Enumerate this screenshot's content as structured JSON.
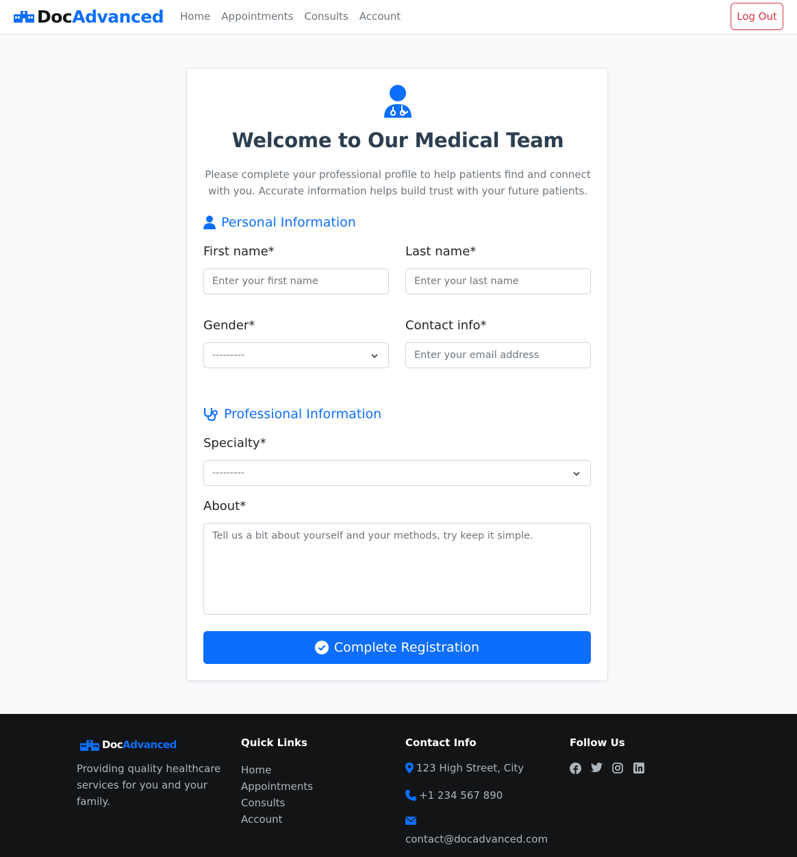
{
  "brand": {
    "part1": "Doc",
    "part2": "Advanced"
  },
  "nav": {
    "links": [
      "Home",
      "Appointments",
      "Consults",
      "Account"
    ],
    "logout_label": "Log Out"
  },
  "card": {
    "title": "Welcome to Our Medical Team",
    "description": "Please complete your professional profile to help patients find and connect with you. Accurate information helps build trust with your future patients.",
    "personal_section": "Personal Information",
    "first_name": {
      "label": "First name*",
      "placeholder": "Enter your first name"
    },
    "last_name": {
      "label": "Last name*",
      "placeholder": "Enter your last name"
    },
    "gender": {
      "label": "Gender*",
      "value": "---------"
    },
    "contact": {
      "label": "Contact info*",
      "placeholder": "Enter your email address"
    },
    "professional_section": "Professional Information",
    "specialty": {
      "label": "Specialty*",
      "value": "---------"
    },
    "about": {
      "label": "About*",
      "placeholder": "Tell us a bit about yourself and your methods, try keep it simple."
    },
    "submit_label": "Complete Registration"
  },
  "footer": {
    "tagline": "Providing quality healthcare services for you and your family.",
    "quick_links_head": "Quick Links",
    "quick_links": [
      "Home",
      "Appointments",
      "Consults",
      "Account"
    ],
    "contact_head": "Contact Info",
    "address": "123 High Street, City",
    "phone": "+1 234 567 890",
    "email": "contact@docadvanced.com",
    "follow_head": "Follow Us",
    "social_icons": [
      "facebook-icon",
      "twitter-icon",
      "instagram-icon",
      "linkedin-icon"
    ]
  },
  "colors": {
    "primary": "#0d6efd",
    "danger": "#dc3545",
    "footer_bg": "#131416",
    "title": "#2c3e50"
  }
}
